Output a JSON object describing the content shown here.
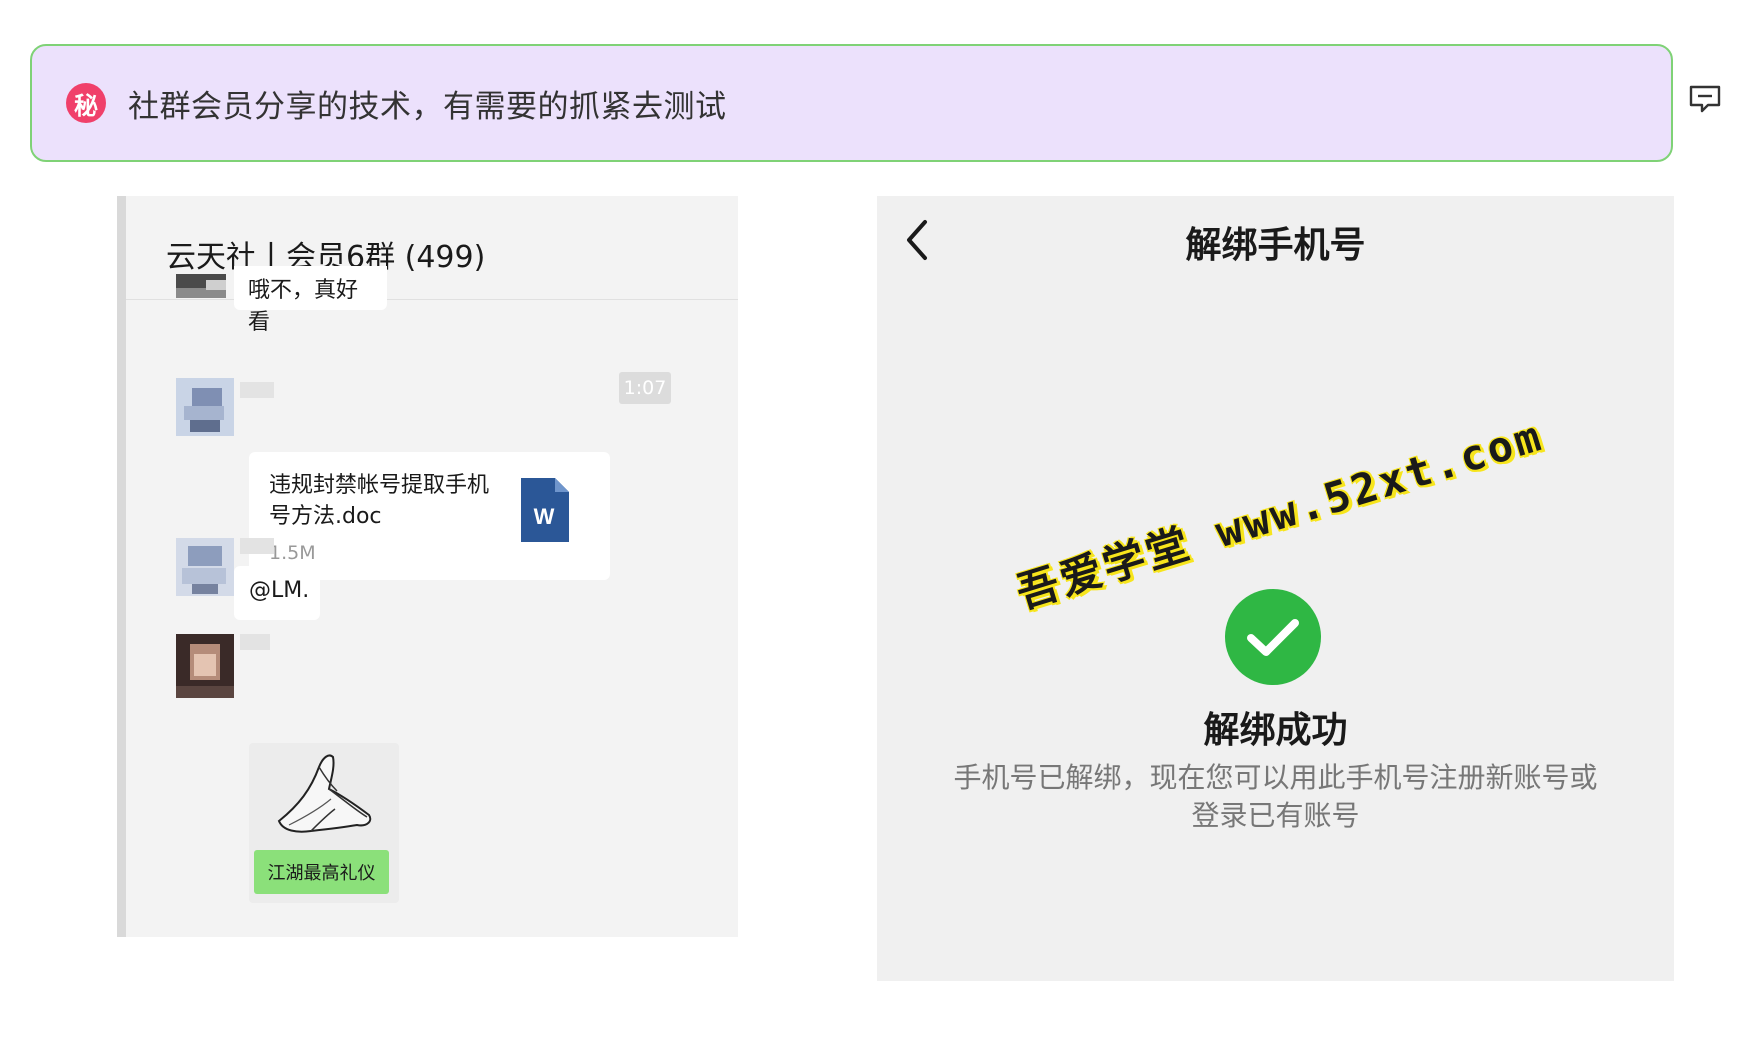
{
  "banner": {
    "badge": "秘",
    "text": "社群会员分享的技术，有需要的抓紧去测试"
  },
  "chat": {
    "title": "云天社丨会员6群 (499)",
    "messages": [
      {
        "type": "text",
        "text": "哦不，真好看"
      },
      {
        "type": "time",
        "text": "1:07"
      },
      {
        "type": "file",
        "file_name": "违规封禁帐号提取手机号方法.doc",
        "file_size": "1.5M",
        "file_icon": "word-icon"
      },
      {
        "type": "text",
        "text": "@LM."
      },
      {
        "type": "sticker",
        "sticker_icon": "praying-hands-icon",
        "caption": "江湖最高礼仪"
      }
    ]
  },
  "phone": {
    "title": "解绑手机号",
    "back_icon": "chevron-left-icon",
    "success_icon": "check-circle-icon",
    "success_title": "解绑成功",
    "success_desc": "手机号已解绑，现在您可以用此手机号注册新账号或登录已有账号",
    "watermark": "吾爱学堂 www.52xt.com"
  },
  "colors": {
    "banner_bg": "#ece1fc",
    "banner_border": "#7fd276",
    "badge": "#f0406a",
    "success_green": "#2fb744",
    "sticker_label": "#8be07a",
    "word_blue": "#2b5797",
    "watermark_highlight": "#f7e51c"
  }
}
